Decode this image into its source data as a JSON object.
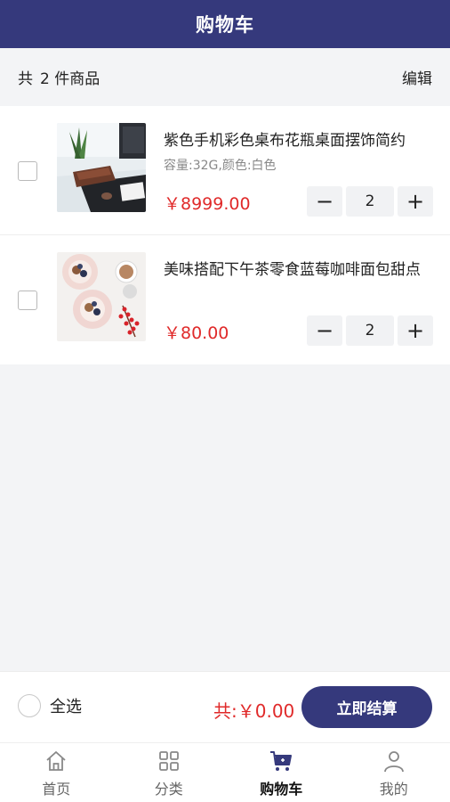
{
  "header": {
    "title": "购物车"
  },
  "summary": {
    "count_prefix": "共",
    "count_text": "2 件商品",
    "edit_label": "编辑"
  },
  "items": [
    {
      "name": "紫色手机彩色桌布花瓶桌面摆饰简约",
      "spec": "容量:32G,颜色:白色",
      "price": "￥8999.00",
      "quantity": "2",
      "image": "desk-workspace-photo"
    },
    {
      "name": "美味搭配下午茶零食蓝莓咖啡面包甜点",
      "spec": "",
      "price": "￥80.00",
      "quantity": "2",
      "image": "afternoon-tea-photo"
    }
  ],
  "stepper": {
    "minus": "−",
    "plus": "+"
  },
  "checkout": {
    "select_all_label": "全选",
    "total_label": "共:￥0.00",
    "button_label": "立即结算"
  },
  "tabs": [
    {
      "label": "首页",
      "icon": "home-icon",
      "active": false
    },
    {
      "label": "分类",
      "icon": "category-grid-icon",
      "active": false
    },
    {
      "label": "购物车",
      "icon": "cart-icon",
      "active": true
    },
    {
      "label": "我的",
      "icon": "user-icon",
      "active": false
    }
  ],
  "colors": {
    "brand": "#35397c",
    "price": "#e02a2a",
    "background": "#f3f4f6"
  }
}
